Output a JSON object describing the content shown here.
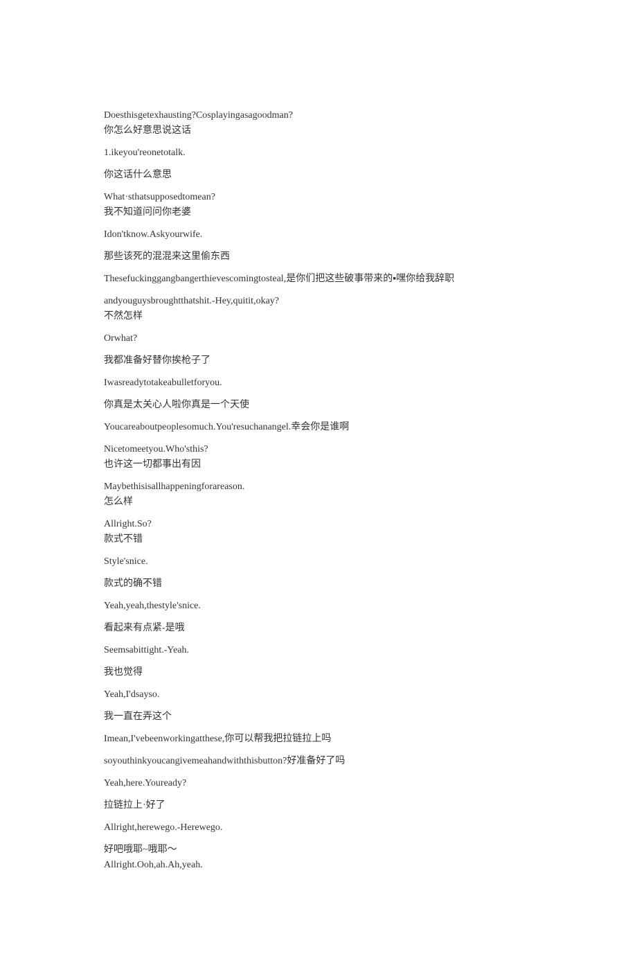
{
  "blocks": [
    {
      "lines": [
        "Doesthisgetexhausting?Cosplayingasagoodman?",
        "你怎么好意思说这话"
      ]
    },
    {
      "lines": [
        "1.ikeyou'reonetotalk."
      ]
    },
    {
      "lines": [
        "你这话什么意思"
      ]
    },
    {
      "lines": [
        "What·sthatsupposedtomean?",
        "我不知道问问你老婆"
      ]
    },
    {
      "lines": [
        "Idon'tknow.Askyourwife."
      ]
    },
    {
      "lines": [
        "那些该死的混混来这里偷东西"
      ]
    },
    {
      "lines": [
        "Thesefuckinggangbangerthievescomingtosteal,是你们把这些破事带来的▪嘿你给我辞职"
      ]
    },
    {
      "lines": [
        "andyouguysbroughtthatshit.-Hey,quitit,okay?",
        "不然怎样"
      ]
    },
    {
      "lines": [
        "Orwhat?"
      ]
    },
    {
      "lines": [
        "我都准备好替你挨枪子了"
      ]
    },
    {
      "lines": [
        "Iwasreadytotakeabulletforyou."
      ]
    },
    {
      "lines": [
        "你真是太关心人啦你真是一个天使"
      ]
    },
    {
      "lines": [
        "Youcareaboutpeoplesomuch.You'resuchanangel.幸会你是谁啊"
      ]
    },
    {
      "lines": [
        "Nicetomeetyou.Who'sthis?",
        "也许这一切都事出有因"
      ]
    },
    {
      "lines": [
        "Maybethisisallhappeningforareason.",
        "怎么样"
      ]
    },
    {
      "lines": [
        "Allright.So?",
        "款式不错"
      ]
    },
    {
      "lines": [
        "Style'snice."
      ]
    },
    {
      "lines": [
        "款式的确不错"
      ]
    },
    {
      "lines": [
        "Yeah,yeah,thestyle'snice."
      ]
    },
    {
      "lines": [
        "看起来有点紧-是哦"
      ]
    },
    {
      "lines": [
        "Seemsabittight.-Yeah."
      ]
    },
    {
      "lines": [
        "我也觉得"
      ]
    },
    {
      "lines": [
        "Yeah,I'dsayso."
      ]
    },
    {
      "lines": [
        "我一直在弄这个"
      ]
    },
    {
      "lines": [
        "Imean,I'vebeenworkingatthese,你可以帮我把拉链拉上吗"
      ]
    },
    {
      "lines": [
        "soyouthinkyoucangivemeahandwiththisbutton?好准备好了吗"
      ]
    },
    {
      "lines": [
        "Yeah,here.Youready?"
      ]
    },
    {
      "lines": [
        "拉链拉上·好了"
      ]
    },
    {
      "lines": [
        "Allright,herewego.-Herewego."
      ]
    },
    {
      "lines": [
        "好吧哦耶~哦耶～",
        "Allright.Ooh,ah.Ah,yeah."
      ]
    }
  ]
}
